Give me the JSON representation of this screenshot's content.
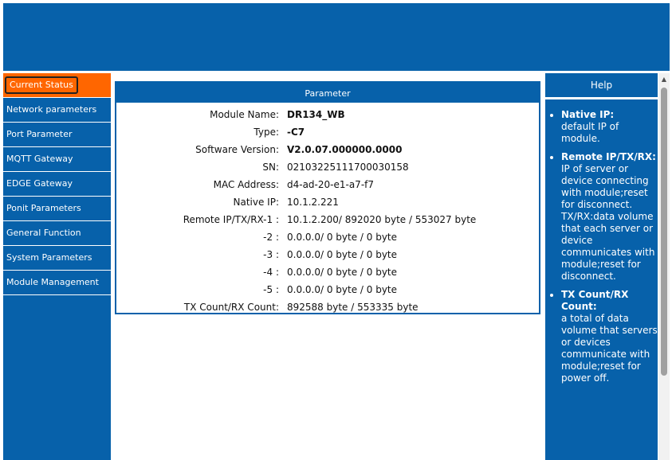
{
  "sidebar": {
    "items": [
      {
        "label": "Current Status"
      },
      {
        "label": "Network parameters"
      },
      {
        "label": "Port Parameter"
      },
      {
        "label": "MQTT Gateway"
      },
      {
        "label": "EDGE Gateway"
      },
      {
        "label": "Ponit Parameters"
      },
      {
        "label": "General Function"
      },
      {
        "label": "System Parameters"
      },
      {
        "label": "Module Management"
      }
    ]
  },
  "parameter": {
    "title": "Parameter",
    "rows": [
      {
        "label": "Module Name:",
        "value": "DR134_WB"
      },
      {
        "label": "Type:",
        "value": "-C7"
      },
      {
        "label": "Software Version:",
        "value": "V2.0.07.000000.0000"
      },
      {
        "label": "SN:",
        "value": "02103225111700030158"
      },
      {
        "label": "MAC Address:",
        "value": "d4-ad-20-e1-a7-f7"
      },
      {
        "label": "Native IP:",
        "value": "10.1.2.221"
      },
      {
        "label": "Remote IP/TX/RX-1 :",
        "value": "10.1.2.200/ 892020 byte / 553027 byte"
      },
      {
        "label": "-2 :",
        "value": "0.0.0.0/ 0 byte / 0 byte"
      },
      {
        "label": "-3 :",
        "value": "0.0.0.0/ 0 byte / 0 byte"
      },
      {
        "label": "-4 :",
        "value": "0.0.0.0/ 0 byte / 0 byte"
      },
      {
        "label": "-5 :",
        "value": "0.0.0.0/ 0 byte / 0 byte"
      },
      {
        "label": "TX Count/RX Count:",
        "value": "892588 byte / 553335 byte"
      }
    ]
  },
  "help": {
    "title": "Help",
    "items": [
      {
        "term": "Native IP:",
        "desc": "default IP of module."
      },
      {
        "term": "Remote IP/TX/RX:",
        "desc": "IP of server or device connecting with module;reset for disconnect. TX/RX:data volume that each server or device communicates with module;reset for disconnect."
      },
      {
        "term": "TX Count/RX Count:",
        "desc": "a total of data volume that servers or devices communicate with module;reset for power off."
      }
    ]
  },
  "scrollbar": {
    "up_glyph": "▲"
  }
}
